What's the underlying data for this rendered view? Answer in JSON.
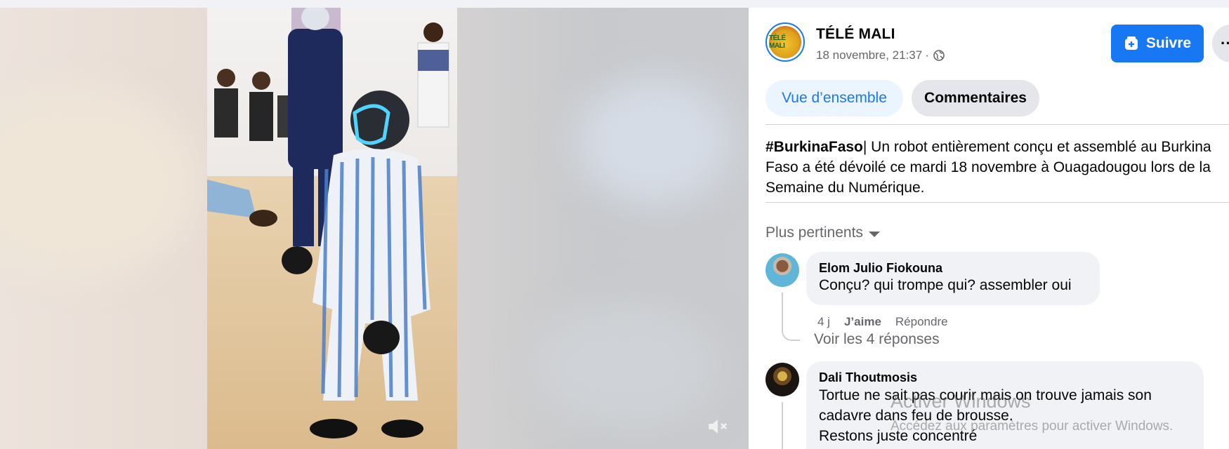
{
  "video": {
    "mute_icon": "speaker-muted-icon"
  },
  "post": {
    "page_name": "TÉLÉ MALI",
    "avatar_text": "TÉLÉ MALI",
    "date": "18 novembre, 21:37",
    "separator": "·",
    "privacy_icon": "globe-icon",
    "follow_label": "Suivre",
    "more_label": "··",
    "tabs": [
      {
        "label": "Vue d’ensemble",
        "active": true
      },
      {
        "label": "Commentaires",
        "active": false
      }
    ],
    "caption": {
      "hashtag": "#BurkinaFaso",
      "line1": "| Un robot entièrement conçu et assemblé au Burkina",
      "line2": "Faso a été dévoilé ce mardi 18 novembre à Ouagadougou lors de la",
      "line3": "Semaine du Numérique."
    }
  },
  "comments": {
    "sort_label": "Plus pertinents",
    "items": [
      {
        "author": "Elom Julio Fiokouna",
        "text": "Conçu? qui trompe qui? assembler oui",
        "age": "4 j",
        "like_label": "J’aime",
        "reply_label": "Répondre",
        "replies_label": "Voir les 4 réponses"
      },
      {
        "author": "Dali Thoutmosis",
        "lines": [
          "Tortue ne sait pas courir mais on trouve jamais son",
          "cadavre dans feu de brousse.",
          "Restons juste concentré"
        ]
      }
    ]
  },
  "watermark": {
    "title": "Activer Windows",
    "subtitle": "Accédez aux paramètres pour activer Windows."
  },
  "colors": {
    "accent": "#1877f2",
    "text": "#050505",
    "muted": "#65676b",
    "bubble": "#f0f2f5"
  }
}
